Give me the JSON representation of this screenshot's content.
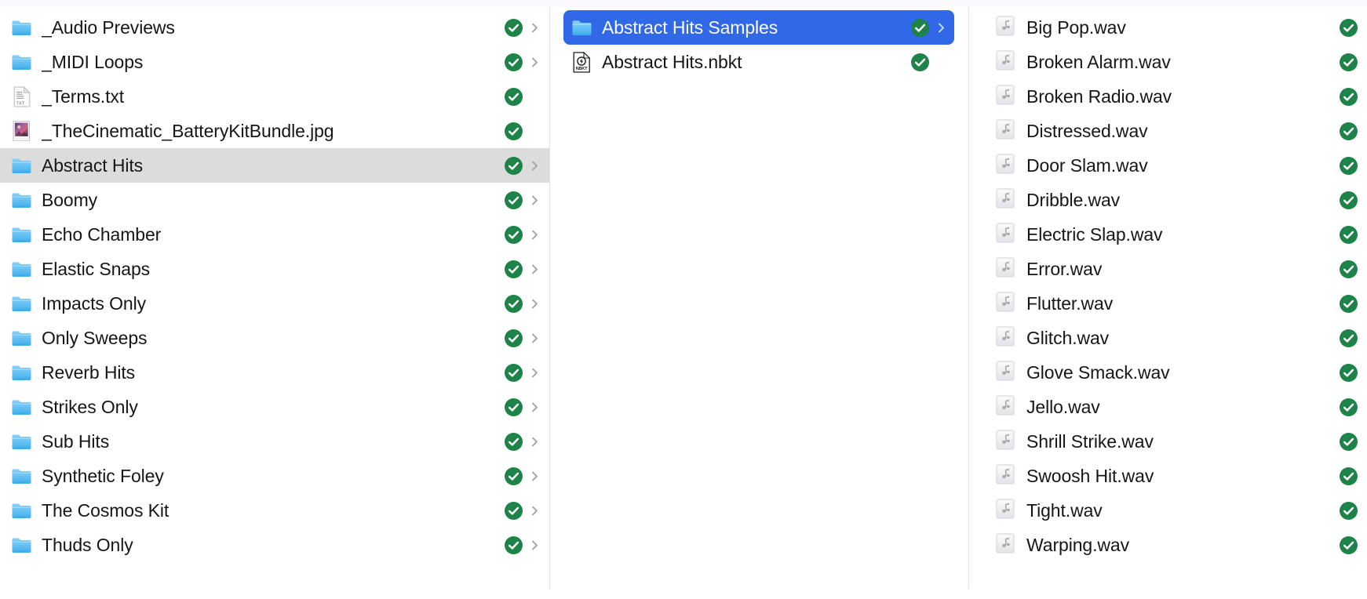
{
  "window": {
    "title": "Abstract Hits Samples",
    "view_mode": "column-view",
    "colors": {
      "selection_active": "#3068e8",
      "selection_inactive": "#dcdcdc",
      "badge_green": "#1d8348",
      "folder_blue": "#54b9f0",
      "divider": "#e2e2e4",
      "text": "#161617",
      "chevron_gray": "#a0a0a5"
    }
  },
  "columns": [
    {
      "name": "column-1",
      "items": [
        {
          "label": "_Audio Previews",
          "icon": "folder-icon",
          "kind": "folder",
          "badge": "check-badge",
          "chevron": true,
          "selected": false
        },
        {
          "label": "_MIDI Loops",
          "icon": "folder-icon",
          "kind": "folder",
          "badge": "check-badge",
          "chevron": true,
          "selected": false
        },
        {
          "label": "_Terms.txt",
          "icon": "text-file-icon",
          "kind": "file",
          "badge": "check-badge",
          "chevron": false,
          "selected": false
        },
        {
          "label": "_TheCinematic_BatteryKitBundle.jpg",
          "icon": "image-file-icon",
          "kind": "file",
          "badge": "check-badge",
          "chevron": false,
          "selected": false
        },
        {
          "label": "Abstract Hits",
          "icon": "folder-icon",
          "kind": "folder",
          "badge": "check-badge",
          "chevron": true,
          "selected": true
        },
        {
          "label": "Boomy",
          "icon": "folder-icon",
          "kind": "folder",
          "badge": "check-badge",
          "chevron": true,
          "selected": false
        },
        {
          "label": "Echo Chamber",
          "icon": "folder-icon",
          "kind": "folder",
          "badge": "check-badge",
          "chevron": true,
          "selected": false
        },
        {
          "label": "Elastic Snaps",
          "icon": "folder-icon",
          "kind": "folder",
          "badge": "check-badge",
          "chevron": true,
          "selected": false
        },
        {
          "label": "Impacts Only",
          "icon": "folder-icon",
          "kind": "folder",
          "badge": "check-badge",
          "chevron": true,
          "selected": false
        },
        {
          "label": "Only Sweeps",
          "icon": "folder-icon",
          "kind": "folder",
          "badge": "check-badge",
          "chevron": true,
          "selected": false
        },
        {
          "label": "Reverb Hits",
          "icon": "folder-icon",
          "kind": "folder",
          "badge": "check-badge",
          "chevron": true,
          "selected": false
        },
        {
          "label": "Strikes Only",
          "icon": "folder-icon",
          "kind": "folder",
          "badge": "check-badge",
          "chevron": true,
          "selected": false
        },
        {
          "label": "Sub Hits",
          "icon": "folder-icon",
          "kind": "folder",
          "badge": "check-badge",
          "chevron": true,
          "selected": false
        },
        {
          "label": "Synthetic Foley",
          "icon": "folder-icon",
          "kind": "folder",
          "badge": "check-badge",
          "chevron": true,
          "selected": false
        },
        {
          "label": "The Cosmos Kit",
          "icon": "folder-icon",
          "kind": "folder",
          "badge": "check-badge",
          "chevron": true,
          "selected": false
        },
        {
          "label": "Thuds Only",
          "icon": "folder-icon",
          "kind": "folder",
          "badge": "check-badge",
          "chevron": true,
          "selected": false
        }
      ]
    },
    {
      "name": "column-2",
      "items": [
        {
          "label": "Abstract Hits Samples",
          "icon": "folder-icon",
          "kind": "folder",
          "badge": "check-badge",
          "chevron": true,
          "selected": true
        },
        {
          "label": "Abstract Hits.nbkt",
          "icon": "nbkt-file-icon",
          "kind": "file",
          "badge": "check-badge",
          "chevron": false,
          "selected": false
        }
      ]
    },
    {
      "name": "column-3",
      "items": [
        {
          "label": "Big Pop.wav",
          "icon": "audio-file-icon",
          "kind": "file",
          "badge": "check-badge",
          "chevron": false,
          "selected": false
        },
        {
          "label": "Broken Alarm.wav",
          "icon": "audio-file-icon",
          "kind": "file",
          "badge": "check-badge",
          "chevron": false,
          "selected": false
        },
        {
          "label": "Broken Radio.wav",
          "icon": "audio-file-icon",
          "kind": "file",
          "badge": "check-badge",
          "chevron": false,
          "selected": false
        },
        {
          "label": "Distressed.wav",
          "icon": "audio-file-icon",
          "kind": "file",
          "badge": "check-badge",
          "chevron": false,
          "selected": false
        },
        {
          "label": "Door Slam.wav",
          "icon": "audio-file-icon",
          "kind": "file",
          "badge": "check-badge",
          "chevron": false,
          "selected": false
        },
        {
          "label": "Dribble.wav",
          "icon": "audio-file-icon",
          "kind": "file",
          "badge": "check-badge",
          "chevron": false,
          "selected": false
        },
        {
          "label": "Electric Slap.wav",
          "icon": "audio-file-icon",
          "kind": "file",
          "badge": "check-badge",
          "chevron": false,
          "selected": false
        },
        {
          "label": "Error.wav",
          "icon": "audio-file-icon",
          "kind": "file",
          "badge": "check-badge",
          "chevron": false,
          "selected": false
        },
        {
          "label": "Flutter.wav",
          "icon": "audio-file-icon",
          "kind": "file",
          "badge": "check-badge",
          "chevron": false,
          "selected": false
        },
        {
          "label": "Glitch.wav",
          "icon": "audio-file-icon",
          "kind": "file",
          "badge": "check-badge",
          "chevron": false,
          "selected": false
        },
        {
          "label": "Glove Smack.wav",
          "icon": "audio-file-icon",
          "kind": "file",
          "badge": "check-badge",
          "chevron": false,
          "selected": false
        },
        {
          "label": "Jello.wav",
          "icon": "audio-file-icon",
          "kind": "file",
          "badge": "check-badge",
          "chevron": false,
          "selected": false
        },
        {
          "label": "Shrill Strike.wav",
          "icon": "audio-file-icon",
          "kind": "file",
          "badge": "check-badge",
          "chevron": false,
          "selected": false
        },
        {
          "label": "Swoosh Hit.wav",
          "icon": "audio-file-icon",
          "kind": "file",
          "badge": "check-badge",
          "chevron": false,
          "selected": false
        },
        {
          "label": "Tight.wav",
          "icon": "audio-file-icon",
          "kind": "file",
          "badge": "check-badge",
          "chevron": false,
          "selected": false
        },
        {
          "label": "Warping.wav",
          "icon": "audio-file-icon",
          "kind": "file",
          "badge": "check-badge",
          "chevron": false,
          "selected": false
        }
      ]
    }
  ],
  "icon_labels": {
    "text_file_badge": "TXT",
    "nbkt_file_badge": "NBKT"
  }
}
